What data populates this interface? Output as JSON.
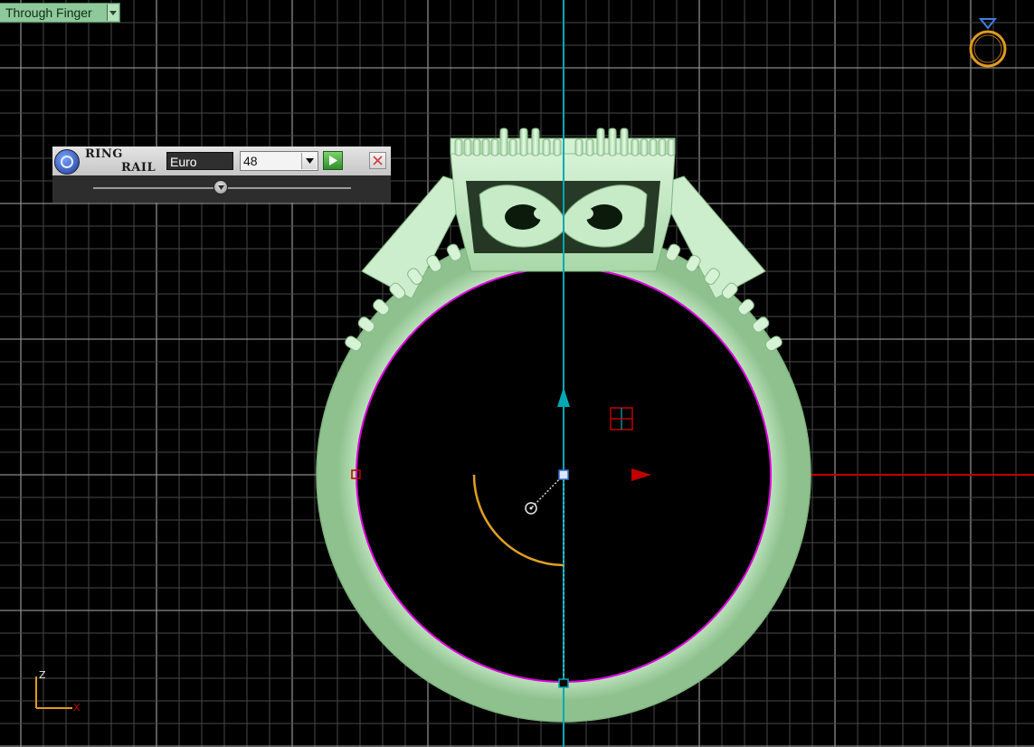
{
  "view_label": {
    "text": "Through Finger",
    "icon": "chevron-down-icon"
  },
  "ring_rail_panel": {
    "title_line1": "RING",
    "title_line2": "RAIL",
    "unit_field": "Euro",
    "size_select": {
      "value": "48"
    },
    "icons": {
      "logo": "ring-rail-logo-icon",
      "apply": "play-icon",
      "close": "close-icon",
      "slider": "slider-thumb-icon"
    }
  },
  "axis_indicator": {
    "z_label": "Z",
    "x_label": "X"
  },
  "colors": {
    "background": "#000000",
    "grid": "#6e6e6e",
    "ring_body": "#c8ecc8",
    "ring_inner_edge": "#e000e0",
    "z_axis": "#00a8b4",
    "x_axis": "#c00000",
    "gauge_arc": "#e0a020",
    "view_label_bg": "#8fc89a"
  }
}
